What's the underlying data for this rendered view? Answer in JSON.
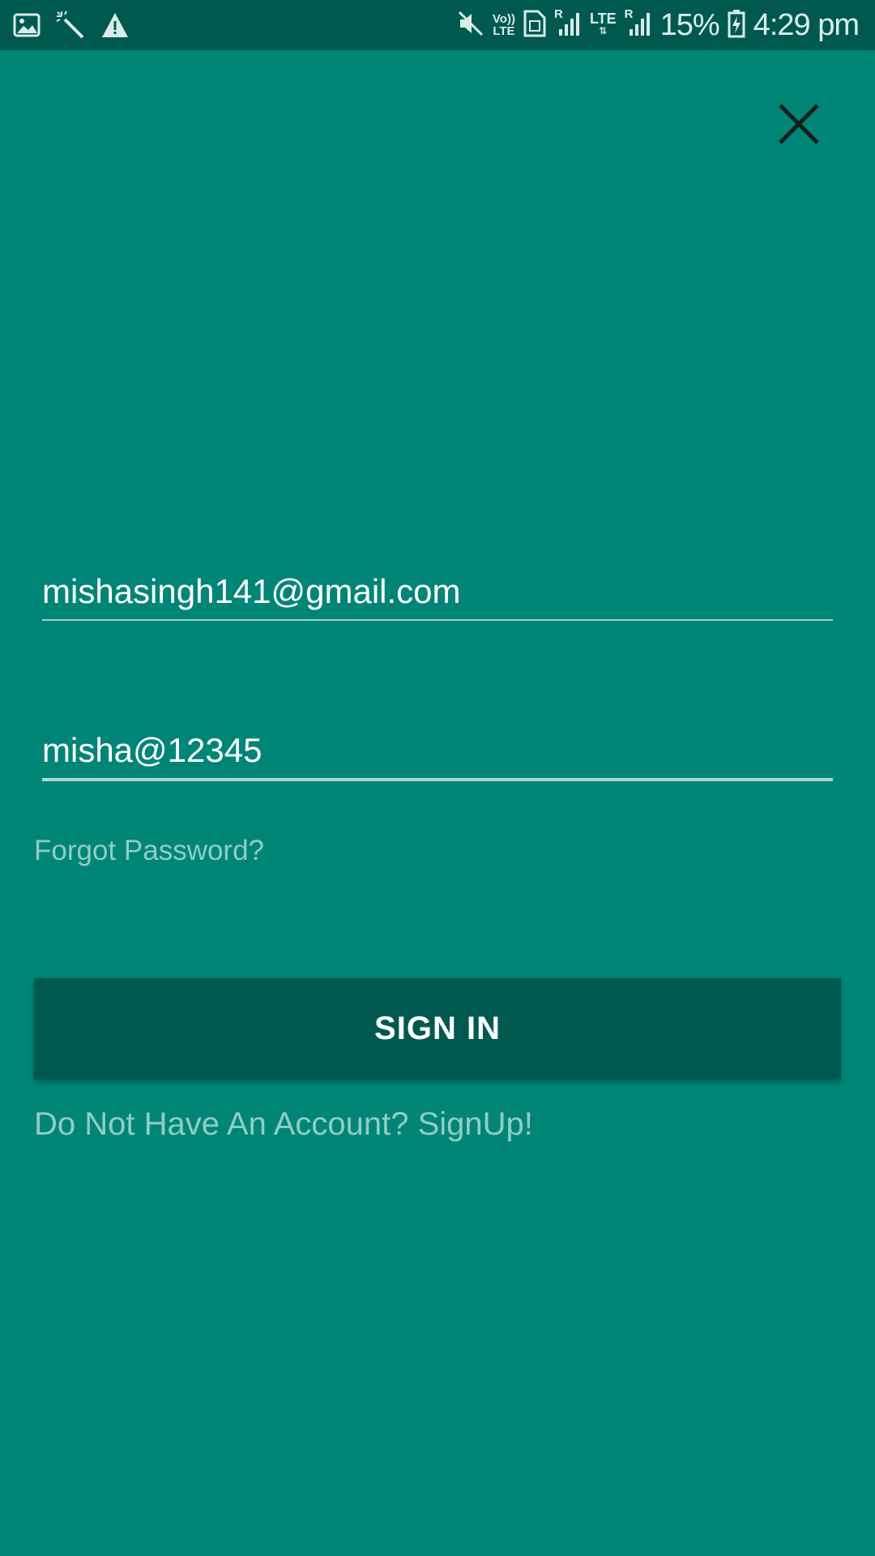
{
  "status_bar": {
    "left_icons": [
      "image-icon",
      "magic-wand-icon",
      "warning-icon"
    ],
    "volte_top": "Vo))",
    "volte_bottom": "LTE",
    "lte_label": "LTE",
    "roaming_1": "R",
    "roaming_2": "R",
    "battery_percent": "15%",
    "time": "4:29 pm"
  },
  "close_button": {
    "icon": "close-icon"
  },
  "form": {
    "email_value": "mishasingh141@gmail.com",
    "password_value": "misha@12345",
    "forgot_password": "Forgot Password?",
    "sign_in_label": "SIGN IN",
    "signup_prompt": "Do Not Have An Account? SignUp!"
  },
  "colors": {
    "background": "#018577",
    "status_bar": "#00594f",
    "button": "#00594f",
    "link_text": "#8fcdc4"
  }
}
